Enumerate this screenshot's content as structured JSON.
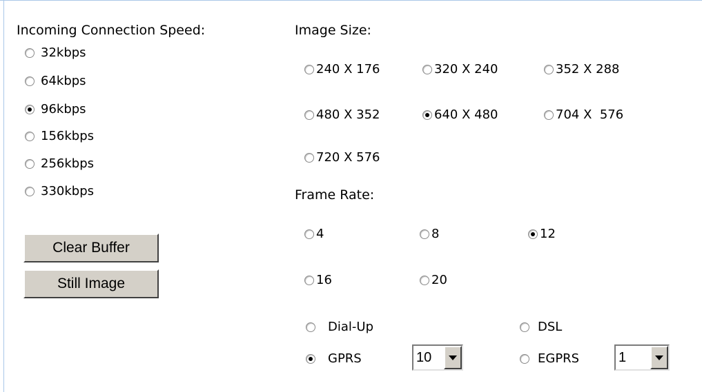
{
  "speed": {
    "title": "Incoming Connection Speed:",
    "options": [
      {
        "label": "32kbps",
        "selected": false
      },
      {
        "label": "64kbps",
        "selected": false
      },
      {
        "label": "96kbps",
        "selected": true
      },
      {
        "label": "156kbps",
        "selected": false
      },
      {
        "label": "256kbps",
        "selected": false
      },
      {
        "label": "330kbps",
        "selected": false
      }
    ]
  },
  "buttons": {
    "clear_buffer": "Clear Buffer",
    "still_image": "Still Image"
  },
  "image_size": {
    "title": "Image Size:",
    "options": [
      {
        "label": "240 X 176",
        "selected": false
      },
      {
        "label": "320 X 240",
        "selected": false
      },
      {
        "label": "352 X 288",
        "selected": false
      },
      {
        "label": "480 X 352",
        "selected": false
      },
      {
        "label": "640 X 480",
        "selected": true
      },
      {
        "label": "704 X  576",
        "selected": false
      },
      {
        "label": "720 X 576",
        "selected": false
      }
    ]
  },
  "frame_rate": {
    "title": "Frame Rate:",
    "options": [
      {
        "label": "4",
        "selected": false
      },
      {
        "label": "8",
        "selected": false
      },
      {
        "label": "12",
        "selected": true
      },
      {
        "label": "16",
        "selected": false
      },
      {
        "label": "20",
        "selected": false
      }
    ]
  },
  "network": {
    "options": [
      {
        "label": "Dial-Up",
        "selected": false
      },
      {
        "label": "DSL",
        "selected": false
      },
      {
        "label": "GPRS",
        "selected": true
      },
      {
        "label": "EGPRS",
        "selected": false
      }
    ],
    "gprs_select_value": "10",
    "egprs_select_value": "1"
  }
}
